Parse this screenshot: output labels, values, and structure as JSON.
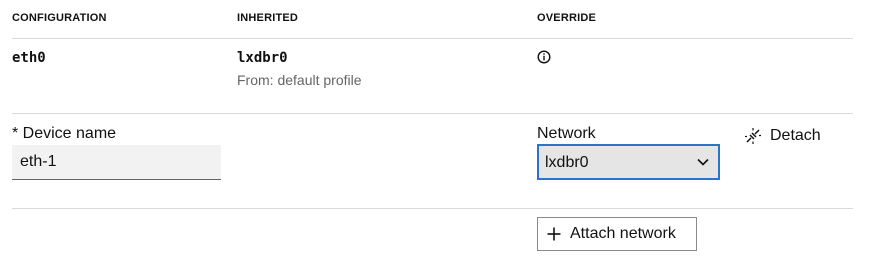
{
  "table": {
    "headers": {
      "configuration": "CONFIGURATION",
      "inherited": "INHERITED",
      "override": "OVERRIDE"
    },
    "row": {
      "name": "eth0",
      "inherited_value": "lxdbr0",
      "inherited_source": "From: default profile",
      "override_icon": "info-icon"
    }
  },
  "device": {
    "name_label": "* Device name",
    "name_value": "eth-1",
    "network_label": "Network",
    "network_selected": "lxdbr0",
    "detach_label": "Detach",
    "detach_icon": "disconnect-icon"
  },
  "actions": {
    "attach_label": "Attach network",
    "attach_icon": "plus-icon"
  },
  "colors": {
    "focus_border": "#2b74c9",
    "divider": "#d9d9d9",
    "muted_text": "#666666"
  }
}
